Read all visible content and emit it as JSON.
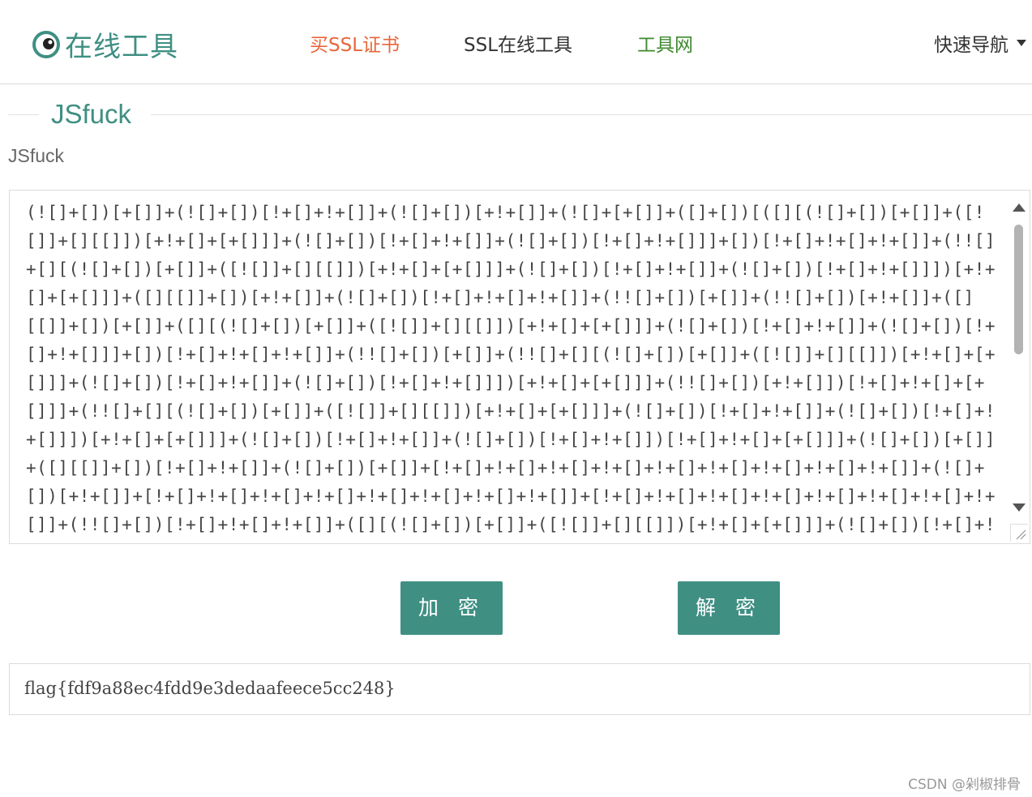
{
  "header": {
    "logo_text": "在线工具",
    "nav": {
      "buy_ssl": "买SSL证书",
      "ssl_tools": "SSL在线工具",
      "tools_site": "工具网",
      "quick_nav": "快速导航"
    },
    "colors": {
      "brand": "#3f8f83",
      "buy_ssl": "#e8663a",
      "tools_site": "#3f8a2f"
    }
  },
  "section": {
    "title": "JSfuck",
    "subtitle": "JSfuck"
  },
  "editor": {
    "content": "(![]+[])[+[]]+(![]+[])[!+[]+!+[]]+(![]+[])[+!+[]]+(![]+[+[]]+([]+[])[([][(![]+[])[+[]]+([![]]+[][[]])[+!+[]+[+[]]]+(![]+[])[!+[]+!+[]]+(![]+[])[!+[]+!+[]]]+[])[!+[]+!+[]+!+[]]+(!![]+[][(![]+[])[+[]]+([![]]+[][[]])[+!+[]+[+[]]]+(![]+[])[!+[]+!+[]]+(![]+[])[!+[]+!+[]]])[+!+[]+[+[]]]+([][[]]+[])[+!+[]]+(![]+[])[!+[]+!+[]+!+[]]+(!![]+[])[+[]]+(!![]+[])[+!+[]]+([][[]]+[])[+[]]+([][(![]+[])[+[]]+([![]]+[][[]])[+!+[]+[+[]]]+(![]+[])[!+[]+!+[]]+(![]+[])[!+[]+!+[]]]+[])[!+[]+!+[]+!+[]]+(!![]+[])[+[]]+(!![]+[][(![]+[])[+[]]+([![]]+[][[]])[+!+[]+[+[]]]+(![]+[])[!+[]+!+[]]+(![]+[])[!+[]+!+[]]])[+!+[]+[+[]]]+(!![]+[])[+!+[]])[!+[]+!+[]+[+[]]]+(!![]+[][(![]+[])[+[]]+([![]]+[][[]])[+!+[]+[+[]]]+(![]+[])[!+[]+!+[]]+(![]+[])[!+[]+!+[]]])[+!+[]+[+[]]]+(![]+[])[!+[]+!+[]]+(![]+[])[!+[]+!+[]])[!+[]+!+[]+[+[]]]+(![]+[])[+[]]+([][[]]+[])[!+[]+!+[]]+(![]+[])[+[]]+[!+[]+!+[]+!+[]+!+[]+!+[]+!+[]+!+[]+!+[]+!+[]]+(![]+[])[+!+[]]+[!+[]+!+[]+!+[]+!+[]+!+[]+!+[]+!+[]+!+[]]+[!+[]+!+[]+!+[]+!+[]+!+[]+!+[]+!+[]+!+[]]+(!![]+[])[!+[]+!+[]+!+[]]+([][(![]+[])[+[]]+([![]]+[][[]])[+!+[]+[+[]]]+(![]+[])[!+[]+!+[]]+(![]+[])[!+[]+!+[]+!+[]]]+[])[!+[]+!+[]+!+[]]+[!+[]+!+[]+!+[]+!+[]]+(![]+[])[+[]]+([][[]]+[])[!+[]+!+[]]+([][[]]+[])[!+[]+!+[]]"
  },
  "buttons": {
    "encrypt": "加 密",
    "decrypt": "解 密"
  },
  "result": {
    "value": "flag{fdf9a88ec4fdd9e3dedaafeece5cc248}"
  },
  "watermark": "CSDN @剁椒排骨"
}
